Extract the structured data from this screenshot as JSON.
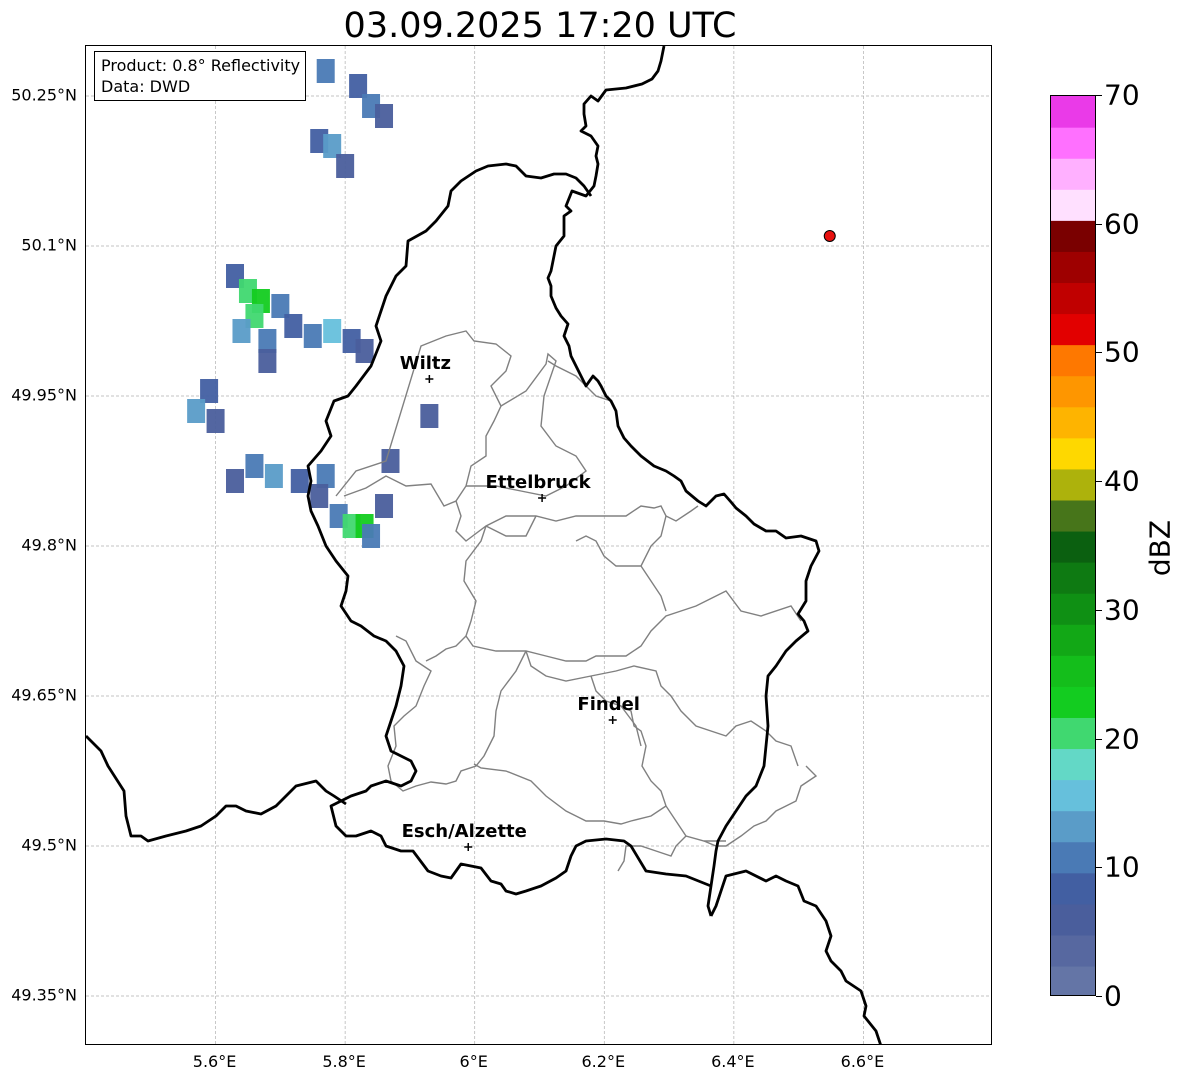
{
  "title": "03.09.2025 17:20 UTC",
  "info": {
    "product_line": "Product: 0.8° Reflectivity",
    "data_line": "Data: DWD"
  },
  "axes": {
    "lon_range": [
      5.4,
      6.8
    ],
    "lat_range": [
      49.3,
      50.3
    ],
    "x_ticks": [
      {
        "value": 5.6,
        "label": "5.6°E"
      },
      {
        "value": 5.8,
        "label": "5.8°E"
      },
      {
        "value": 6.0,
        "label": "6°E"
      },
      {
        "value": 6.2,
        "label": "6.2°E"
      },
      {
        "value": 6.4,
        "label": "6.4°E"
      },
      {
        "value": 6.6,
        "label": "6.6°E"
      }
    ],
    "y_ticks": [
      {
        "value": 50.25,
        "label": "50.25°N"
      },
      {
        "value": 50.1,
        "label": "50.1°N"
      },
      {
        "value": 49.95,
        "label": "49.95°N"
      },
      {
        "value": 49.8,
        "label": "49.8°N"
      },
      {
        "value": 49.65,
        "label": "49.65°N"
      },
      {
        "value": 49.5,
        "label": "49.5°N"
      },
      {
        "value": 49.35,
        "label": "49.35°N"
      }
    ],
    "grid": true
  },
  "cities": [
    {
      "name": "Wiltz",
      "lon": 5.93,
      "lat": 49.967
    },
    {
      "name": "Ettelbruck",
      "lon": 6.104,
      "lat": 49.848
    },
    {
      "name": "Findel",
      "lon": 6.213,
      "lat": 49.626
    },
    {
      "name": "Esch/Alzette",
      "lon": 5.99,
      "lat": 49.499
    }
  ],
  "radar_site": {
    "lon": 6.548,
    "lat": 50.11,
    "color": "#e8110f"
  },
  "colorbar": {
    "label": "dBZ",
    "min": 0,
    "max": 70,
    "step": 2.5,
    "ticks": [
      {
        "value": 0,
        "label": "0"
      },
      {
        "value": 10,
        "label": "10"
      },
      {
        "value": 20,
        "label": "20"
      },
      {
        "value": 30,
        "label": "30"
      },
      {
        "value": 40,
        "label": "40"
      },
      {
        "value": 50,
        "label": "50"
      },
      {
        "value": 60,
        "label": "60"
      },
      {
        "value": 70,
        "label": "70"
      }
    ],
    "colors": [
      "#6475a6",
      "#5768a0",
      "#4a5e9c",
      "#425fa2",
      "#4a7ab5",
      "#5a9cc8",
      "#66c0dc",
      "#63d8c6",
      "#40d870",
      "#13cc20",
      "#14be1b",
      "#12a816",
      "#0f9014",
      "#0e7a12",
      "#0b6010",
      "#47751a",
      "#adb20c",
      "#fed800",
      "#feb400",
      "#fe9600",
      "#fe7800",
      "#e20000",
      "#c00000",
      "#9e0000",
      "#7a0000",
      "#ffe0ff",
      "#ffb0ff",
      "#ff70ff",
      "#ea3ae8"
    ]
  },
  "echo_cells": [
    {
      "lon": 5.77,
      "lat": 50.275,
      "dbz": 12
    },
    {
      "lon": 5.82,
      "lat": 50.26,
      "dbz": 8
    },
    {
      "lon": 5.84,
      "lat": 50.24,
      "dbz": 12
    },
    {
      "lon": 5.86,
      "lat": 50.23,
      "dbz": 6
    },
    {
      "lon": 5.76,
      "lat": 50.205,
      "dbz": 8
    },
    {
      "lon": 5.78,
      "lat": 50.2,
      "dbz": 14
    },
    {
      "lon": 5.8,
      "lat": 50.18,
      "dbz": 6
    },
    {
      "lon": 5.63,
      "lat": 50.07,
      "dbz": 8
    },
    {
      "lon": 5.65,
      "lat": 50.055,
      "dbz": 22
    },
    {
      "lon": 5.67,
      "lat": 50.045,
      "dbz": 24
    },
    {
      "lon": 5.66,
      "lat": 50.03,
      "dbz": 20
    },
    {
      "lon": 5.7,
      "lat": 50.04,
      "dbz": 10
    },
    {
      "lon": 5.72,
      "lat": 50.02,
      "dbz": 8
    },
    {
      "lon": 5.64,
      "lat": 50.015,
      "dbz": 14
    },
    {
      "lon": 5.68,
      "lat": 50.005,
      "dbz": 12
    },
    {
      "lon": 5.75,
      "lat": 50.01,
      "dbz": 10
    },
    {
      "lon": 5.78,
      "lat": 50.015,
      "dbz": 16
    },
    {
      "lon": 5.81,
      "lat": 50.005,
      "dbz": 8
    },
    {
      "lon": 5.83,
      "lat": 49.995,
      "dbz": 6
    },
    {
      "lon": 5.68,
      "lat": 49.985,
      "dbz": 6
    },
    {
      "lon": 5.59,
      "lat": 49.955,
      "dbz": 8
    },
    {
      "lon": 5.57,
      "lat": 49.935,
      "dbz": 14
    },
    {
      "lon": 5.6,
      "lat": 49.925,
      "dbz": 6
    },
    {
      "lon": 5.93,
      "lat": 49.93,
      "dbz": 6
    },
    {
      "lon": 5.66,
      "lat": 49.88,
      "dbz": 10
    },
    {
      "lon": 5.69,
      "lat": 49.87,
      "dbz": 14
    },
    {
      "lon": 5.73,
      "lat": 49.865,
      "dbz": 8
    },
    {
      "lon": 5.77,
      "lat": 49.87,
      "dbz": 12
    },
    {
      "lon": 5.76,
      "lat": 49.85,
      "dbz": 6
    },
    {
      "lon": 5.87,
      "lat": 49.885,
      "dbz": 6
    },
    {
      "lon": 5.63,
      "lat": 49.865,
      "dbz": 6
    },
    {
      "lon": 5.79,
      "lat": 49.83,
      "dbz": 10
    },
    {
      "lon": 5.81,
      "lat": 49.82,
      "dbz": 22
    },
    {
      "lon": 5.83,
      "lat": 49.82,
      "dbz": 24
    },
    {
      "lon": 5.86,
      "lat": 49.84,
      "dbz": 6
    },
    {
      "lon": 5.84,
      "lat": 49.81,
      "dbz": 12
    }
  ]
}
